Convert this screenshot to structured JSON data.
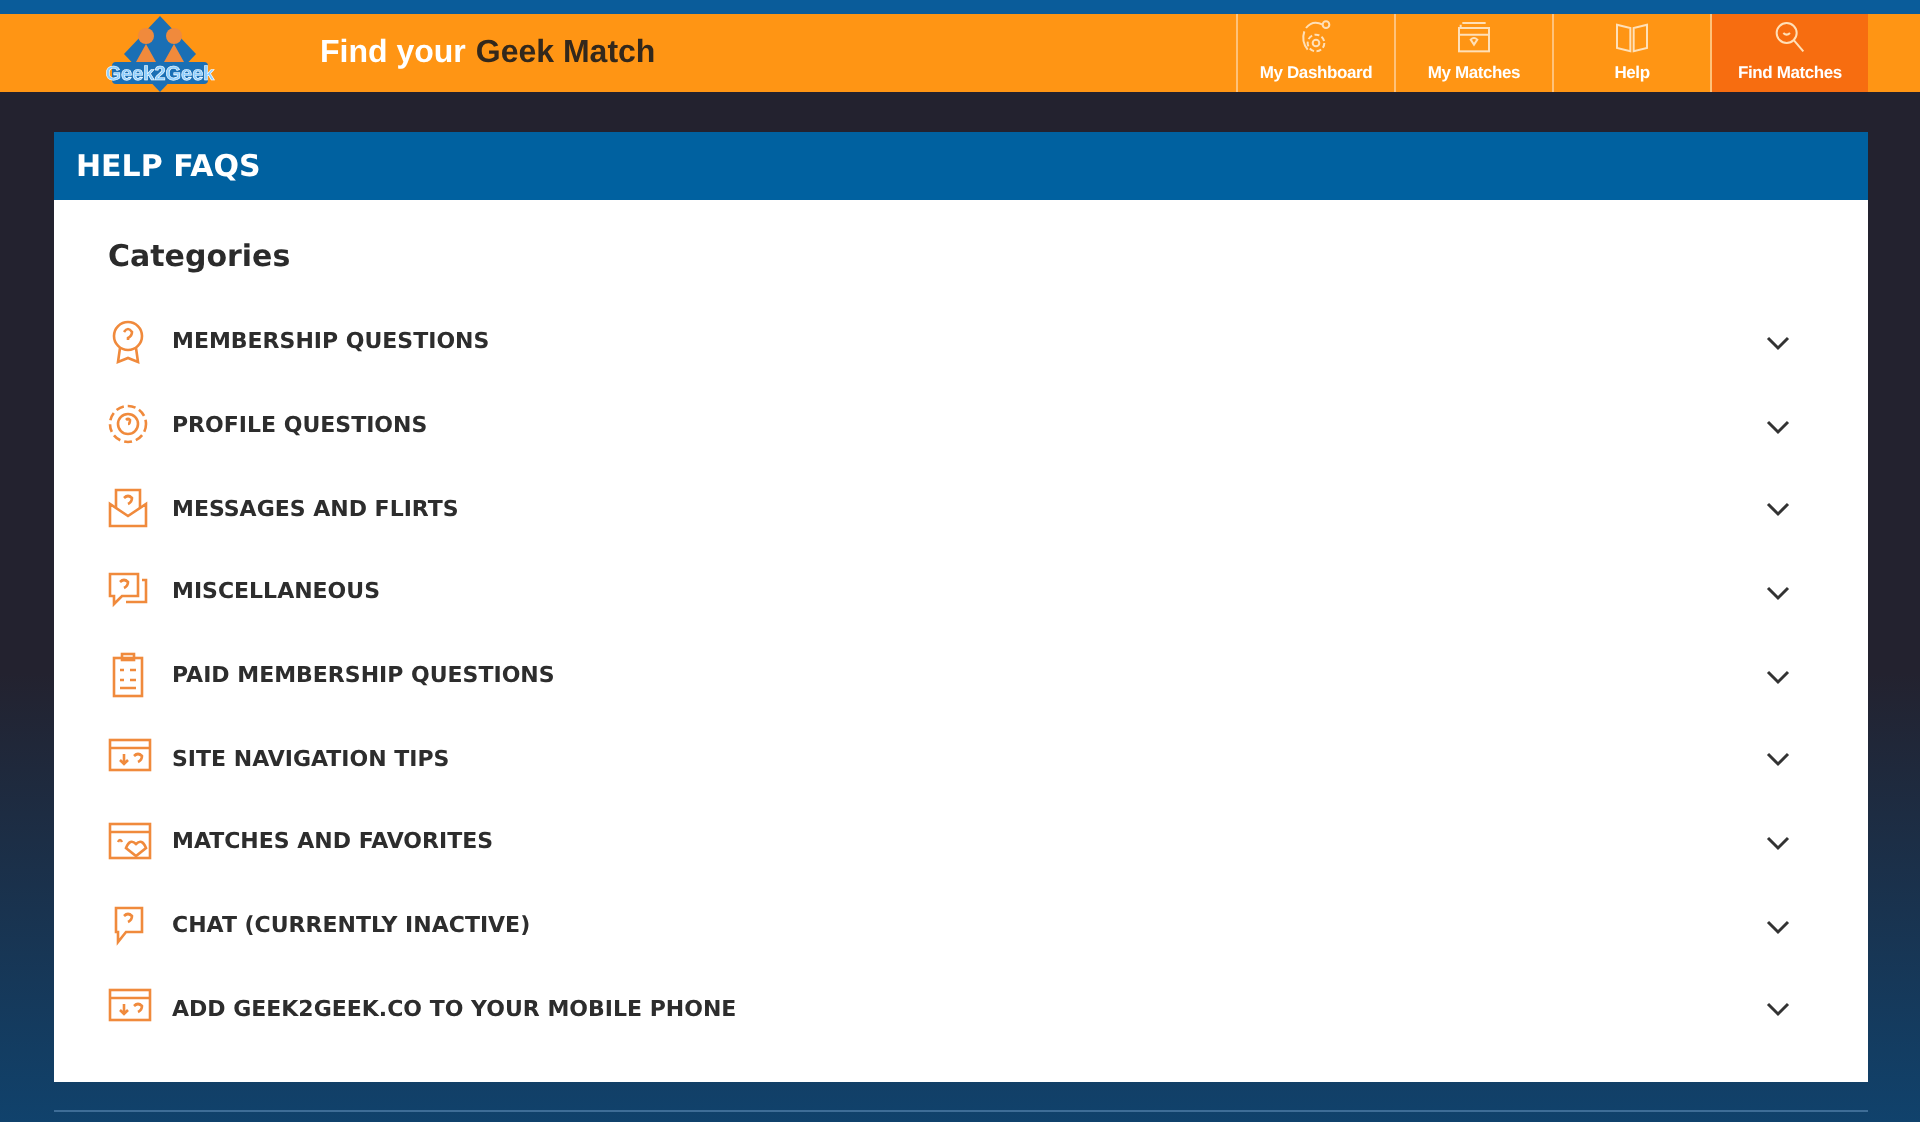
{
  "header": {
    "logo_text": "Geek2Geek",
    "title_lead": "Find your",
    "title_highlight": "Geek Match",
    "nav": [
      {
        "label": "My Dashboard",
        "selected": false
      },
      {
        "label": "My Matches",
        "selected": false
      },
      {
        "label": "Help",
        "selected": false
      },
      {
        "label": "Find Matches",
        "selected": true
      }
    ]
  },
  "panel": {
    "title": "HELP FAQS",
    "heading": "Categories",
    "categories": [
      {
        "label": "MEMBERSHIP QUESTIONS",
        "expanded": false
      },
      {
        "label": "PROFILE QUESTIONS",
        "expanded": false
      },
      {
        "label": "MESSAGES AND FLIRTS",
        "expanded": false
      },
      {
        "label": "MISCELLANEOUS",
        "expanded": false
      },
      {
        "label": "PAID MEMBERSHIP QUESTIONS",
        "expanded": false
      },
      {
        "label": "SITE NAVIGATION TIPS",
        "expanded": false
      },
      {
        "label": "MATCHES AND FAVORITES",
        "expanded": false
      },
      {
        "label": "CHAT (CURRENTLY INACTIVE)",
        "expanded": false
      },
      {
        "label": "ADD GEEK2GEEK.CO TO YOUR MOBILE PHONE",
        "expanded": false
      }
    ]
  }
}
